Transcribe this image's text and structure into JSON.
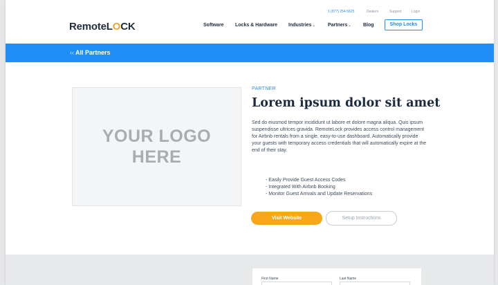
{
  "header": {
    "logo": {
      "prefix": "RemoteL",
      "accent": "O",
      "suffix": "CK"
    },
    "utility": {
      "phone": "1 (877) 254-5625",
      "dealers": "Dealers",
      "support": "Support",
      "login": "Login"
    },
    "nav": {
      "software": "Software",
      "locks": "Locks & Hardware",
      "industries": "Industries",
      "partners": "Partners",
      "blog": "Blog",
      "shop": "Shop Locks"
    }
  },
  "breadcrumb": {
    "back_label": "All Partners"
  },
  "partner": {
    "logo_placeholder": "YOUR LOGO HERE",
    "eyebrow": "PARTNER",
    "title": "Lorem ipsum dolor sit amet",
    "description": "Sed do eiusmod tempor incididunt ut labore et dolore magna aliqua. Quis ipsum suspendisse ultrices gravida. RemoteLock provides access control management for Airbnb rentals from a single, easy-to-use dashboard. Automatically provide your guests with temporary access credentials that will automatically expire at the end of their stay.",
    "bullets": [
      "- Easily Provide Guest Access Codes",
      "- Integrated With Airbnb Booking",
      "- Monitor Guest Arrivals and Update Reservations"
    ],
    "visit_button": "Visit Website",
    "setup_button": "Setup Instructions"
  },
  "form": {
    "first_name_label": "First Name",
    "last_name_label": "Last Name"
  },
  "colors": {
    "brand_blue": "#1f8ff7",
    "accent_orange": "#f8a718",
    "logo_accent": "#f5a623"
  }
}
